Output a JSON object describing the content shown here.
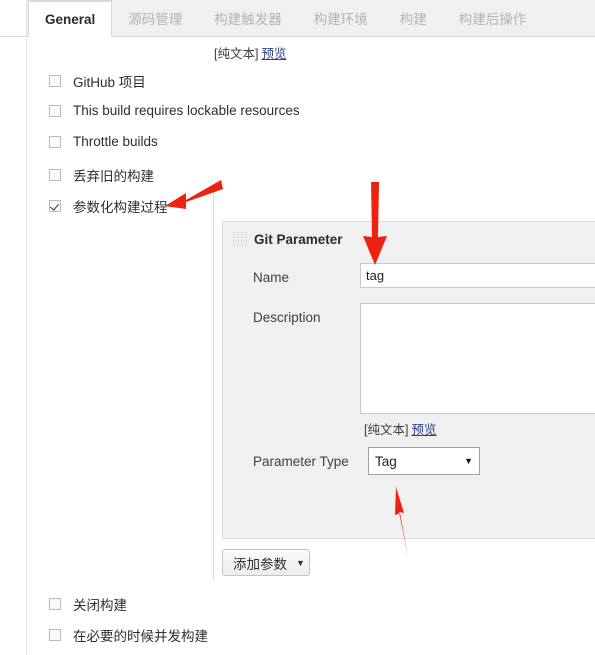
{
  "tabs": [
    {
      "label": "General",
      "active": true
    },
    {
      "label": "源码管理",
      "active": false
    },
    {
      "label": "构建触发器",
      "active": false
    },
    {
      "label": "构建环境",
      "active": false
    },
    {
      "label": "构建",
      "active": false
    },
    {
      "label": "构建后操作",
      "active": false
    }
  ],
  "top_plaintext": {
    "markup_label": "[纯文本]",
    "preview_label": "预览"
  },
  "options": [
    {
      "label": "GitHub 项目",
      "checked": false
    },
    {
      "label": "This build requires lockable resources",
      "checked": false
    },
    {
      "label": "Throttle builds",
      "checked": false
    },
    {
      "label": "丢弃旧的构建",
      "checked": false
    },
    {
      "label": "参数化构建过程",
      "checked": true
    }
  ],
  "parameter_panel": {
    "title": "Git Parameter",
    "drag_handle": "drag-handle-icon",
    "name_label": "Name",
    "name_value": "tag",
    "description_label": "Description",
    "description_value": "",
    "description_plaintext": {
      "markup_label": "[纯文本]",
      "preview_label": "预览"
    },
    "parameter_type_label": "Parameter Type",
    "parameter_type_value": "Tag"
  },
  "add_parameter_button": {
    "label": "添加参数",
    "caret": "▼"
  },
  "bottom_options": [
    {
      "label": "关闭构建",
      "checked": false
    },
    {
      "label": "在必要的时候并发构建",
      "checked": false
    }
  ],
  "annotations": {
    "arrow_color": "#ee2211",
    "arrow1_target": "参数化构建过程",
    "arrow2_target": "Name",
    "arrow3_target": "Parameter Type"
  }
}
